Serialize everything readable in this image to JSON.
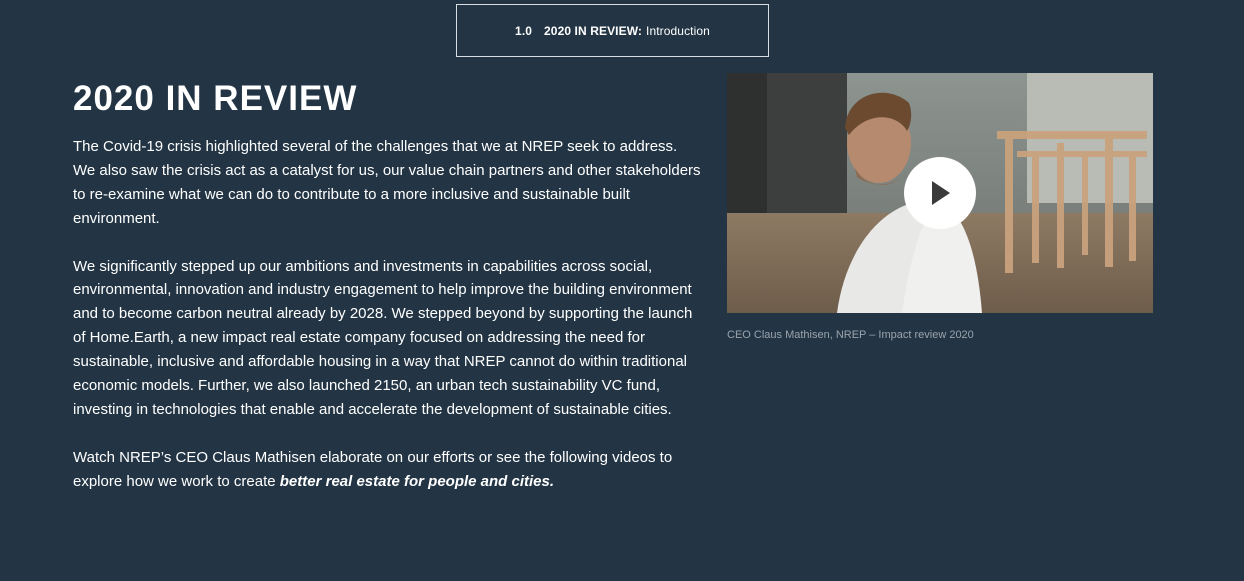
{
  "section_tag": {
    "number": "1.0",
    "title": "2020 IN REVIEW:",
    "subtitle": "Introduction"
  },
  "page_title": "2020 IN REVIEW",
  "paragraphs": [
    "The Covid-19 crisis highlighted several of the challenges that we at NREP seek to address. We also saw the crisis act as a catalyst for us, our value chain partners and other stakeholders to re-examine what we can do to contribute to a more inclusive and sustainable built environment.",
    "We significantly stepped up our ambitions and investments in capabilities across social, environmental, innovation and industry engagement to help improve the building environment and to become carbon neutral already by 2028. We stepped beyond by supporting the launch of Home.Earth, a new impact real estate company focused on addressing the need for sustainable, inclusive and affordable housing in a way that NREP cannot do within traditional economic models. Further, we also launched 2150, an urban tech sustainability VC fund, investing in technologies that enable and accelerate the development of sustainable cities."
  ],
  "closing": {
    "text": "Watch NREP’s CEO Claus Mathisen elaborate on our efforts or see the following videos to explore how we work to create ",
    "emphasis": "better real estate for people and cities."
  },
  "video": {
    "caption": "CEO Claus Mathisen, NREP – Impact review 2020",
    "play_icon": "play-icon"
  },
  "colors": {
    "background": "#233545",
    "text": "#ffffff",
    "caption": "#9aa3ac",
    "border": "#d9dee3"
  }
}
